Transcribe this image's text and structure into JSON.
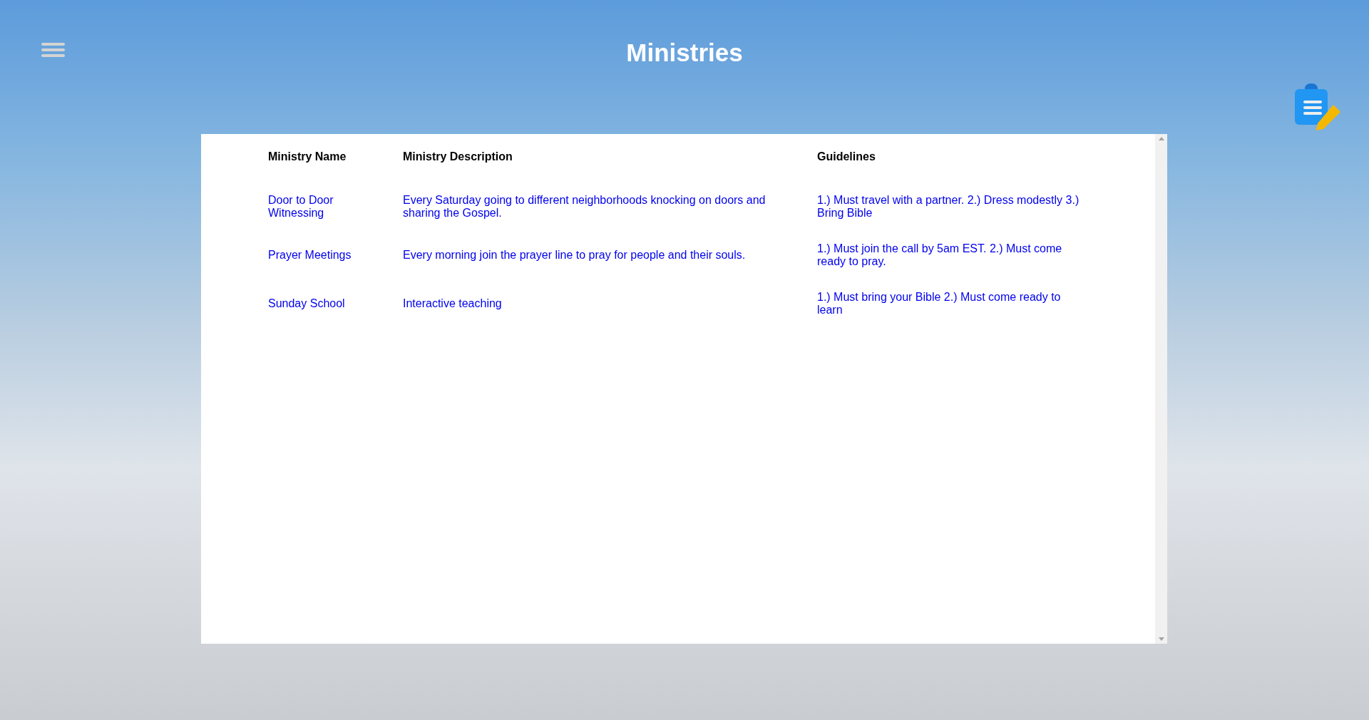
{
  "header": {
    "title": "Ministries"
  },
  "table": {
    "columns": [
      "Ministry Name",
      "Ministry Description",
      "Guidelines"
    ],
    "rows": [
      {
        "cells": [
          "Door to Door Witnessing",
          "Every Saturday going to different neighborhoods knocking on doors and sharing the Gospel.",
          "1.) Must travel with a partner. 2.) Dress modestly 3.) Bring Bible"
        ]
      },
      {
        "cells": [
          "Prayer Meetings",
          "Every morning join the prayer line to pray for people and their souls.",
          "1.) Must join the call by 5am EST. 2.) Must come ready to pray."
        ]
      },
      {
        "cells": [
          "Sunday School",
          "Interactive teaching",
          "1.) Must bring your Bible 2.) Must come ready to learn"
        ]
      }
    ]
  }
}
